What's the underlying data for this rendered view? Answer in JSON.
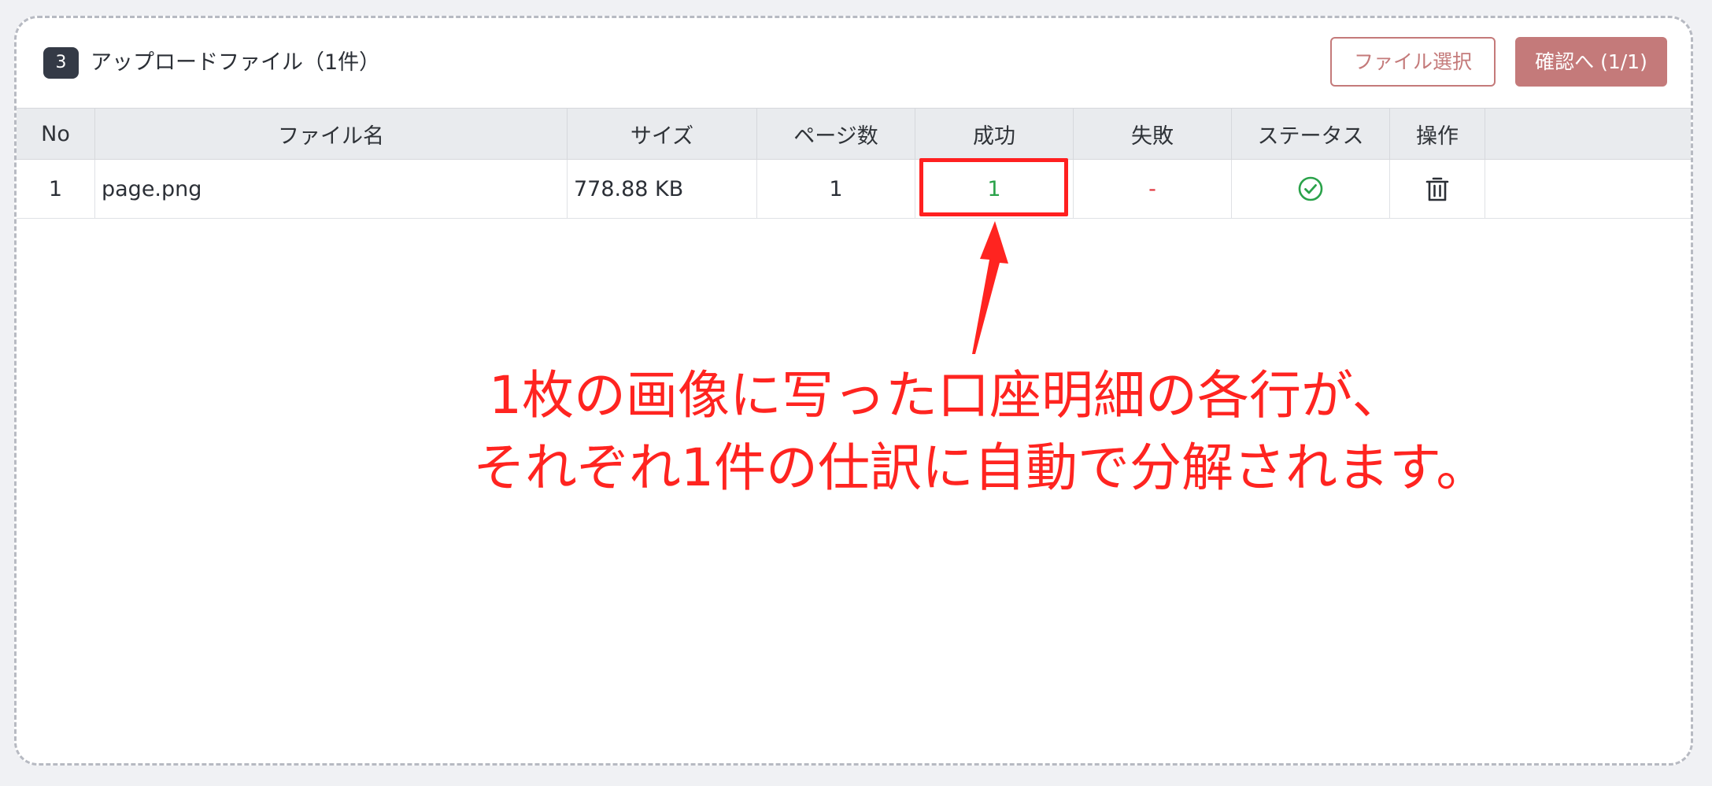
{
  "header": {
    "step_number": "3",
    "title": "アップロードファイル（1件）",
    "select_button": "ファイル選択",
    "confirm_button": "確認へ (1/1)"
  },
  "table": {
    "columns": [
      "No",
      "ファイル名",
      "サイズ",
      "ページ数",
      "成功",
      "失敗",
      "ステータス",
      "操作"
    ],
    "rows": [
      {
        "no": "1",
        "filename": "page.png",
        "size": "778.88 KB",
        "pages": "1",
        "success": "1",
        "fail": "-",
        "status_icon": "check-circle-icon",
        "action_icon": "trash-icon"
      }
    ]
  },
  "annotation": {
    "line1": "1枚の画像に写った口座明細の各行が、",
    "line2": "それぞれ1件の仕訳に自動で分解されます。"
  },
  "colors": {
    "accent": "#c47a7a",
    "success": "#2aa24a",
    "fail": "#e0323a",
    "annotation": "#ff2420"
  }
}
